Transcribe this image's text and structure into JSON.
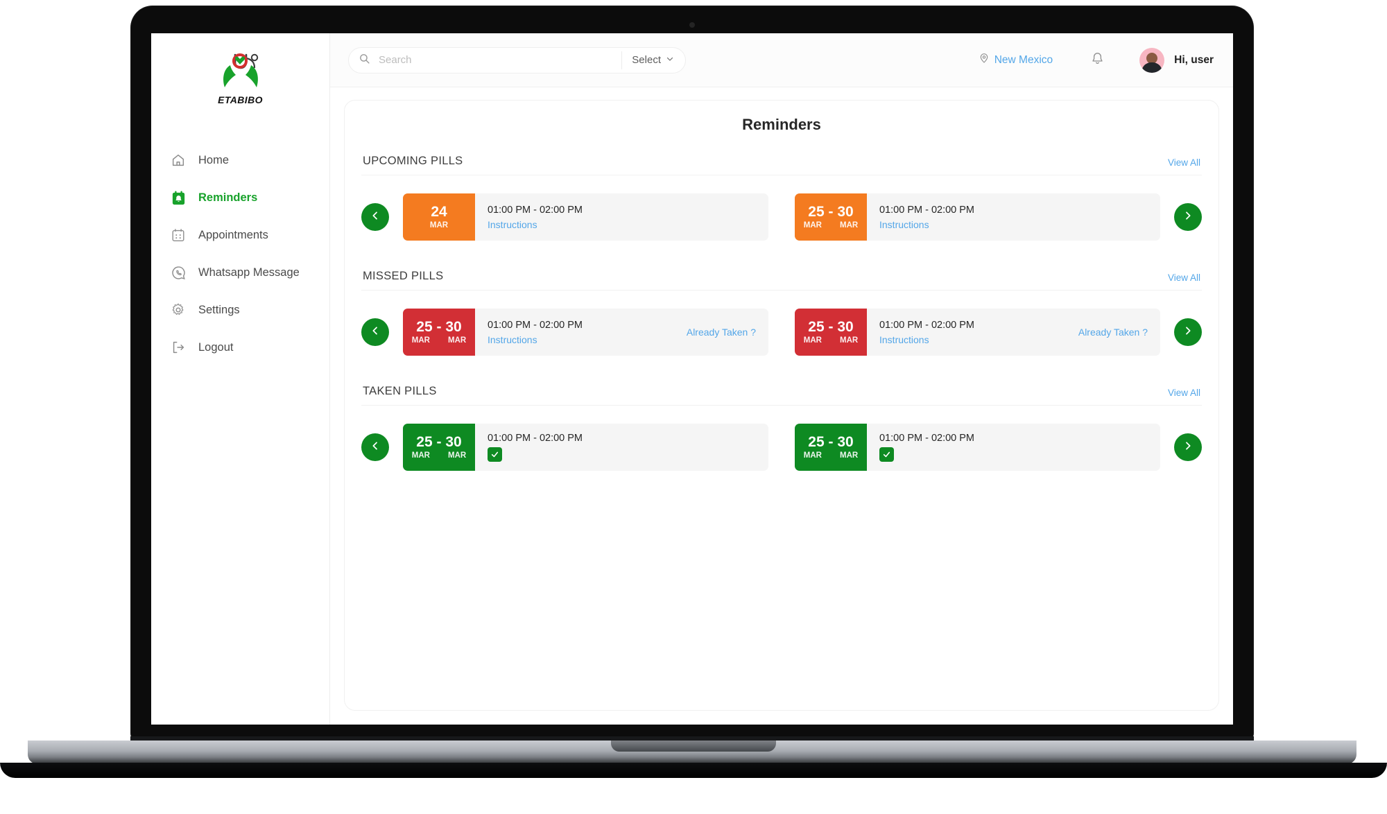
{
  "brand": {
    "name": "ETABIBO",
    "logo_icon": "etabibo-hands-stethoscope-logo"
  },
  "sidebar": {
    "items": [
      {
        "label": "Home",
        "icon": "home-icon",
        "active": false
      },
      {
        "label": "Reminders",
        "icon": "bell-calendar-icon",
        "active": true
      },
      {
        "label": "Appointments",
        "icon": "calendar-icon",
        "active": false
      },
      {
        "label": "Whatsapp Message",
        "icon": "whatsapp-icon",
        "active": false
      },
      {
        "label": "Settings",
        "icon": "gear-icon",
        "active": false
      },
      {
        "label": "Logout",
        "icon": "logout-icon",
        "active": false
      }
    ]
  },
  "topbar": {
    "search": {
      "value": "",
      "placeholder": "Search",
      "icon": "search-icon"
    },
    "select": {
      "label": "Select",
      "icon": "chevron-down-icon"
    },
    "location": {
      "label": "New Mexico",
      "icon": "location-pin-icon"
    },
    "notifications": {
      "icon": "bell-icon"
    },
    "user": {
      "greeting": "Hi, user",
      "avatar_icon": "user-avatar"
    }
  },
  "page": {
    "title": "Reminders"
  },
  "colors": {
    "accent_green": "#0E8A22",
    "link_blue": "#53A6E8",
    "badge_orange": "#F47B20",
    "badge_red": "#D22F35",
    "badge_green": "#0E8A22"
  },
  "sections": [
    {
      "id": "upcoming",
      "title": "UPCOMING PILLS",
      "view_all": "View All",
      "prev_icon": "chevron-left-icon",
      "next_icon": "chevron-right-icon",
      "cards": [
        {
          "date_nums": "24",
          "months": [
            "MAR"
          ],
          "badge": "orange",
          "time": "01:00 PM - 02:00 PM",
          "link": "Instructions",
          "right_link": "",
          "checked": false
        },
        {
          "date_nums": "25 - 30",
          "months": [
            "MAR",
            "MAR"
          ],
          "badge": "orange",
          "time": "01:00 PM - 02:00 PM",
          "link": "Instructions",
          "right_link": "",
          "checked": false
        }
      ]
    },
    {
      "id": "missed",
      "title": "MISSED PILLS",
      "view_all": "View All",
      "prev_icon": "chevron-left-icon",
      "next_icon": "chevron-right-icon",
      "cards": [
        {
          "date_nums": "25 - 30",
          "months": [
            "MAR",
            "MAR"
          ],
          "badge": "red",
          "time": "01:00 PM - 02:00 PM",
          "link": "Instructions",
          "right_link": "Already Taken ?",
          "checked": false
        },
        {
          "date_nums": "25 - 30",
          "months": [
            "MAR",
            "MAR"
          ],
          "badge": "red",
          "time": "01:00 PM - 02:00 PM",
          "link": "Instructions",
          "right_link": "Already Taken ?",
          "checked": false
        }
      ]
    },
    {
      "id": "taken",
      "title": "TAKEN PILLS",
      "view_all": "View All",
      "prev_icon": "chevron-left-icon",
      "next_icon": "chevron-right-icon",
      "cards": [
        {
          "date_nums": "25 - 30",
          "months": [
            "MAR",
            "MAR"
          ],
          "badge": "green",
          "time": "01:00 PM - 02:00 PM",
          "link": "",
          "right_link": "",
          "checked": true
        },
        {
          "date_nums": "25 - 30",
          "months": [
            "MAR",
            "MAR"
          ],
          "badge": "green",
          "time": "01:00 PM - 02:00 PM",
          "link": "",
          "right_link": "",
          "checked": true
        }
      ]
    }
  ]
}
